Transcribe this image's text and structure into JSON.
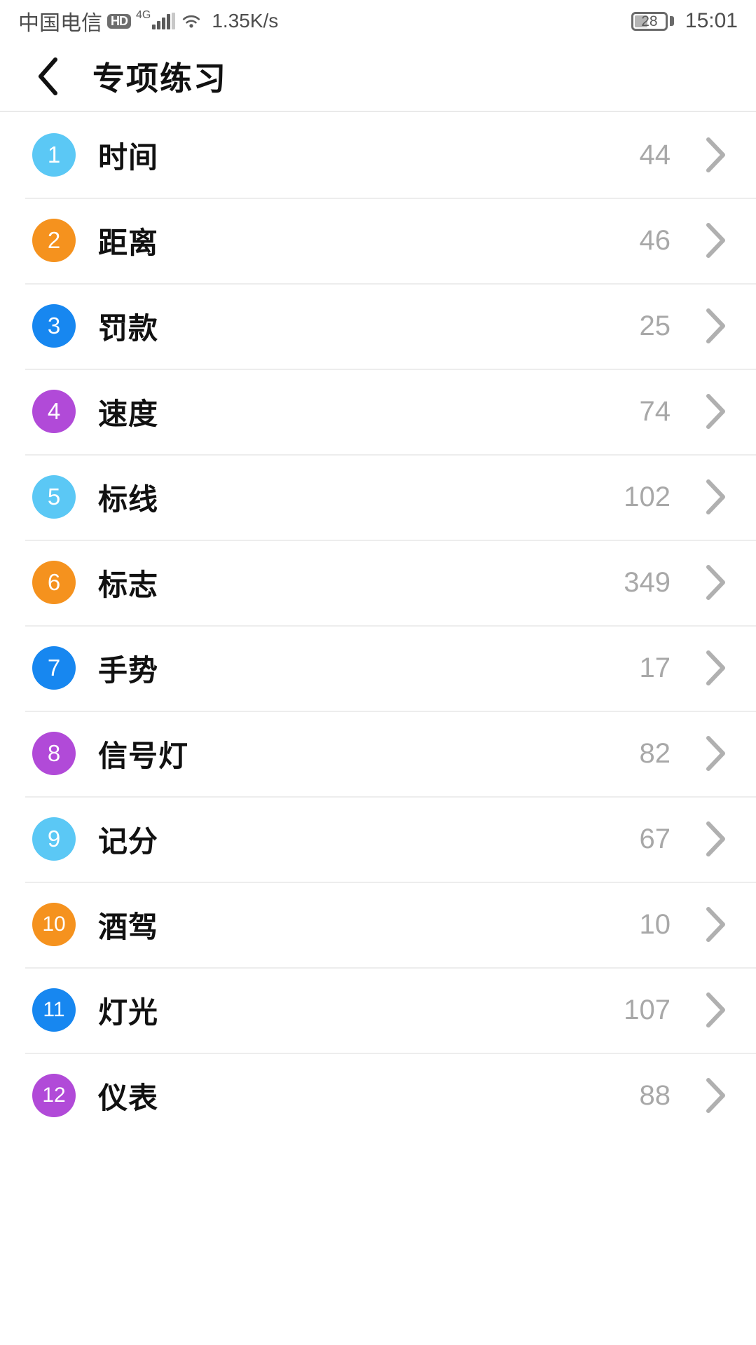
{
  "status_bar": {
    "carrier": "中国电信",
    "hd_label": "HD",
    "network_type": "4G",
    "network_speed": "1.35K/s",
    "battery_level": "28",
    "time": "15:01",
    "icons": {
      "hd": "hd-icon",
      "signal": "signal-bars-icon",
      "wifi": "wifi-icon",
      "battery": "battery-icon"
    }
  },
  "header": {
    "back_icon": "back-chevron-icon",
    "title": "专项练习"
  },
  "colors": {
    "light_blue": "#5BC8F5",
    "orange": "#F5921E",
    "blue": "#1787F0",
    "purple": "#B14AD8",
    "count_gray": "#A8A8A8",
    "divider": "#EDEDED",
    "text": "#111111"
  },
  "list": {
    "items": [
      {
        "index": "1",
        "label": "时间",
        "count": "44",
        "color": "#5BC8F5"
      },
      {
        "index": "2",
        "label": "距离",
        "count": "46",
        "color": "#F5921E"
      },
      {
        "index": "3",
        "label": "罚款",
        "count": "25",
        "color": "#1787F0"
      },
      {
        "index": "4",
        "label": "速度",
        "count": "74",
        "color": "#B14AD8"
      },
      {
        "index": "5",
        "label": "标线",
        "count": "102",
        "color": "#5BC8F5"
      },
      {
        "index": "6",
        "label": "标志",
        "count": "349",
        "color": "#F5921E"
      },
      {
        "index": "7",
        "label": "手势",
        "count": "17",
        "color": "#1787F0"
      },
      {
        "index": "8",
        "label": "信号灯",
        "count": "82",
        "color": "#B14AD8"
      },
      {
        "index": "9",
        "label": "记分",
        "count": "67",
        "color": "#5BC8F5"
      },
      {
        "index": "10",
        "label": "酒驾",
        "count": "10",
        "color": "#F5921E"
      },
      {
        "index": "11",
        "label": "灯光",
        "count": "107",
        "color": "#1787F0"
      },
      {
        "index": "12",
        "label": "仪表",
        "count": "88",
        "color": "#B14AD8"
      }
    ],
    "chevron_icon": "chevron-right-icon"
  }
}
